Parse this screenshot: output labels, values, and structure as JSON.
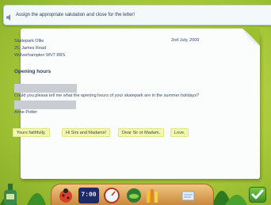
{
  "instruction": "Assign the appropriate salutation and close for the letter!",
  "letter": {
    "recipient_lines": [
      "Skatepark Ollie",
      "25, James Road",
      "Wolverhampton WV7 8RS"
    ],
    "date": "2nd July, 2009",
    "heading": "Opening hours",
    "body": "Could you please tell me what the opening hours of your skatepark are in the summer holidays?",
    "signature": "Anne Potter"
  },
  "options": [
    "Yours faithfully,",
    "Hi Sirs and Madams!",
    "Dear Sir or Madam,",
    "Love,"
  ],
  "toolbar": {
    "clock_text": "7:00"
  },
  "colors": {
    "background": "#a8c83a",
    "paper": "#fbfdfd",
    "option_fill": "#f4f7b0",
    "blank_slot": "#c9ccd2",
    "dock": "#e0a857"
  },
  "icons": [
    "speaker-icon",
    "ladybug-icon",
    "clock-icon",
    "gauge-icon",
    "grasshopper-icon",
    "books-icon",
    "notepad-icon",
    "checkmark-icon",
    "bottle-icon"
  ]
}
